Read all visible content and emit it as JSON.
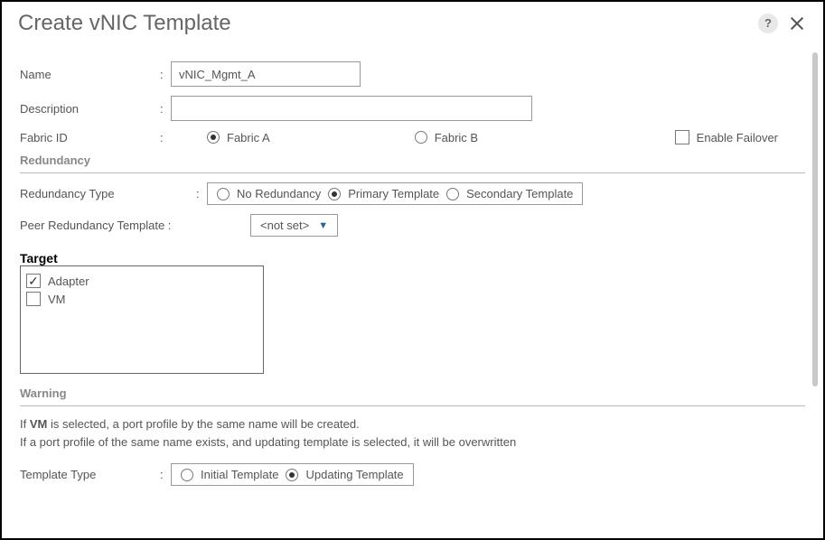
{
  "dialog": {
    "title": "Create vNIC Template",
    "help": "?",
    "close": "×"
  },
  "fields": {
    "name_label": "Name",
    "name_value": "vNIC_Mgmt_A",
    "desc_label": "Description",
    "desc_value": "",
    "fabric_label": "Fabric ID",
    "fabric_a": "Fabric A",
    "fabric_b": "Fabric B",
    "enable_failover": "Enable Failover"
  },
  "redundancy": {
    "section": "Redundancy",
    "type_label": "Redundancy Type",
    "no_red": "No Redundancy",
    "primary": "Primary Template",
    "secondary": "Secondary Template",
    "peer_label": "Peer Redundancy Template :",
    "peer_value": "<not set>"
  },
  "target": {
    "title": "Target",
    "adapter": "Adapter",
    "vm": "VM"
  },
  "warning": {
    "title": "Warning",
    "line1a": "If ",
    "line1b": "VM",
    "line1c": " is selected, a port profile by the same name will be created.",
    "line2": "If a port profile of the same name exists, and updating template is selected, it will be overwritten"
  },
  "template_type": {
    "label": "Template Type",
    "initial": "Initial Template",
    "updating": "Updating Template"
  }
}
